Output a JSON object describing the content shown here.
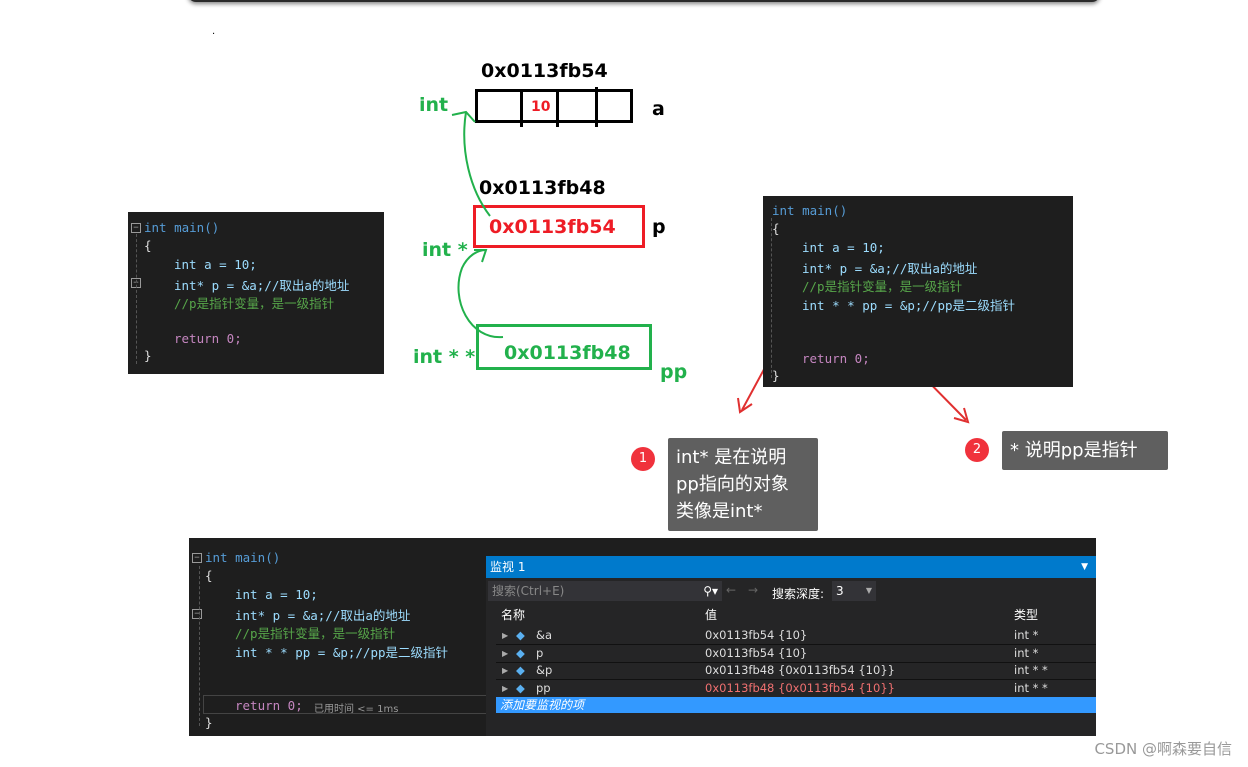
{
  "diagram": {
    "a": {
      "address": "0x0113fb54",
      "value": "10",
      "name": "a",
      "type": "int"
    },
    "p": {
      "address": "0x0113fb48",
      "value": "0x0113fb54",
      "name": "p",
      "type": "int *"
    },
    "pp": {
      "value": "0x0113fb48",
      "name": "pp",
      "type": "int * *"
    },
    "colors": {
      "a": "#000000",
      "p": "#ee1c25",
      "pp": "#22b14c"
    }
  },
  "dot": ".",
  "code_left": [
    "int main()",
    "{",
    "int a = 10;",
    "int* p = &a;//取出a的地址",
    "//p是指针变量，是一级指针",
    "",
    "return 0;",
    "}"
  ],
  "code_right": [
    "int main()",
    "{",
    "int a = 10;",
    "int* p = &a;//取出a的地址",
    "//p是指针变量，是一级指针",
    "int * * pp = &p;//pp是二级指针",
    "",
    "",
    "return 0;",
    "}"
  ],
  "annotations": [
    {
      "num": "1",
      "text_lines": [
        "int* 是在说明",
        "pp指向的对象",
        "类像是int*"
      ]
    },
    {
      "num": "2",
      "text": "* 说明pp是指针"
    }
  ],
  "ide": {
    "code": [
      "int main()",
      "{",
      "int a = 10;",
      "int* p = &a;//取出a的地址",
      "//p是指针变量，是一级指针",
      "int * * pp = &p;//pp是二级指针",
      "return 0;",
      "}"
    ],
    "elapsed": "已用时间 <= 1ms",
    "watch": {
      "title": "监视 1",
      "search_placeholder": "搜索(Ctrl+E)",
      "depth_label": "搜索深度:",
      "depth": "3",
      "columns": [
        "名称",
        "值",
        "类型"
      ],
      "rows": [
        {
          "name": "&a",
          "value": "0x0113fb54 {10}",
          "type": "int *"
        },
        {
          "name": "p",
          "value": "0x0113fb54 {10}",
          "type": "int *"
        },
        {
          "name": "&p",
          "value": "0x0113fb48 {0x0113fb54 {10}}",
          "type": "int * *"
        },
        {
          "name": "pp",
          "value": "0x0113fb48 {0x0113fb54 {10}}",
          "type": "int * *",
          "changed": true
        }
      ],
      "add_item": "添加要监视的项"
    }
  },
  "watermark": "CSDN @啊森要自信"
}
